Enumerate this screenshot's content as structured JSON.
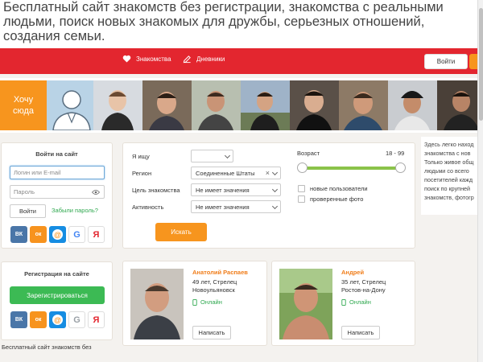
{
  "header": {
    "headline_line1": "Бесплатный сайт знакомств без регистрации, знакомства с реальными",
    "headline_line2": "людьми, поиск новых знакомых для дружбы, серьезных отношений,",
    "headline_line3": "создания семьи."
  },
  "nav": {
    "dating_label": "Знакомства",
    "diaries_label": "Дневники",
    "login_button": "Войти"
  },
  "gallery": {
    "want_here_line1": "Хочу",
    "want_here_line2": "сюда"
  },
  "login": {
    "title": "Войти на сайт",
    "login_placeholder": "Логин или E-mail",
    "password_placeholder": "Пароль",
    "submit_label": "Войти",
    "forgot_label": "Забыли пароль?"
  },
  "register": {
    "title": "Регистрация на сайте",
    "button_label": "Зарегистрироваться"
  },
  "social": {
    "vk": "ВК",
    "ok": "ок",
    "mail": "@",
    "google": "G",
    "yandex": "Я"
  },
  "search": {
    "looking_for_label": "Я ищу",
    "looking_for_value": "",
    "region_label": "Регион",
    "region_value": "Соединенные Штаты",
    "goal_label": "Цель знакомства",
    "goal_value": "Не имеет значения",
    "activity_label": "Активность",
    "activity_value": "Не имеет значения",
    "age_label": "Возраст",
    "age_range": "18 - 99",
    "age_min": 18,
    "age_max": 99,
    "new_users_label": "новые пользователи",
    "verified_photo_label": "проверенные фото",
    "search_button": "Искать"
  },
  "profiles": [
    {
      "name": "Анатолий Распаев",
      "age_sign": "49 лет, Стрелец",
      "city": "Новоульяновск",
      "status": "Онлайн",
      "message_label": "Написать"
    },
    {
      "name": "Андрей",
      "age_sign": "35 лет, Стрелец",
      "city": "Ростов-на-Дону",
      "status": "Онлайн",
      "message_label": "Написать"
    }
  ],
  "footer_text": "Бесплатный сайт знакомств без",
  "sidebar_text": [
    "Здесь легко наход",
    "знакомства с нов",
    "Только живое общ",
    "людьми со всего",
    "посетителей кажд",
    "поиск по крупней",
    "знакомств, фотогр"
  ],
  "colors": {
    "brand_red": "#e3262f",
    "accent_orange": "#f7951e",
    "online_green": "#2fa84f",
    "register_green": "#3cba54"
  }
}
